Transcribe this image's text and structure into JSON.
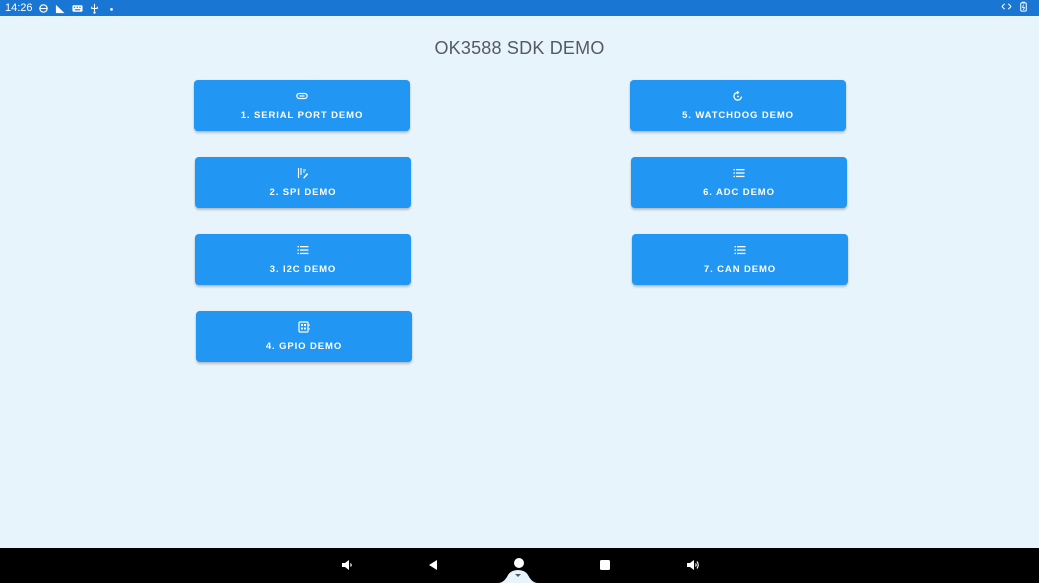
{
  "status_bar": {
    "time": "14:26",
    "left_icons": [
      "sync-icon",
      "no-signal-icon",
      "keyboard-icon",
      "usb-icon",
      "dot-icon"
    ],
    "right_icons": [
      "data-transfer-icon",
      "battery-icon"
    ],
    "background": "#1976d2"
  },
  "app": {
    "title": "OK3588 SDK DEMO",
    "background": "#e8f4fc",
    "button_color": "#2196f3",
    "buttons": [
      {
        "label": "1. SERIAL PORT DEMO",
        "icon": "link-icon"
      },
      {
        "label": "2. SPI DEMO",
        "icon": "list-edit-icon"
      },
      {
        "label": "3. I2C DEMO",
        "icon": "list-icon"
      },
      {
        "label": "4. GPIO DEMO",
        "icon": "chip-icon"
      },
      {
        "label": "5. WATCHDOG DEMO",
        "icon": "refresh-icon"
      },
      {
        "label": "6. ADC DEMO",
        "icon": "list-icon"
      },
      {
        "label": "7. CAN DEMO",
        "icon": "list-icon"
      }
    ]
  },
  "nav_bar": {
    "buttons": [
      "volume-down-icon",
      "back-icon",
      "home-icon",
      "recents-icon",
      "volume-up-icon"
    ],
    "background": "#000000"
  }
}
